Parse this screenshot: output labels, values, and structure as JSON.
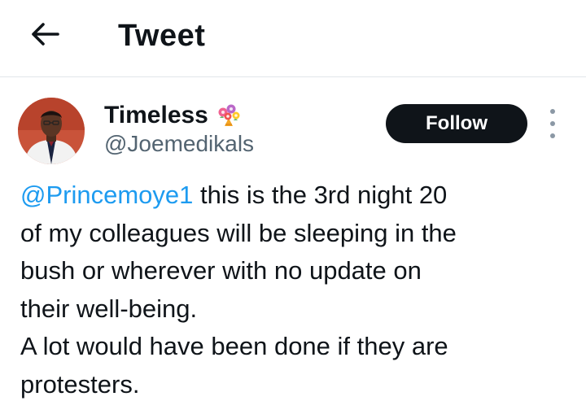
{
  "header": {
    "title": "Tweet",
    "back_icon": "arrow-left-icon"
  },
  "tweet": {
    "author_name": "Timeless",
    "author_emoji_icon": "bouquet-icon",
    "handle": "@Joemedikals",
    "follow_label": "Follow",
    "more_icon": "more-vertical-icon",
    "mention": "@Princemoye1",
    "body": " this is the 3rd night 20\nof my colleagues will be sleeping in the\nbush or wherever with no update on\ntheir well-being.\nA lot would have been done if they are\nprotesters."
  },
  "colors": {
    "text": "#0f1419",
    "secondary_text": "#536471",
    "link": "#1d9bf0",
    "follow_bg": "#0f1419",
    "follow_text": "#ffffff"
  }
}
